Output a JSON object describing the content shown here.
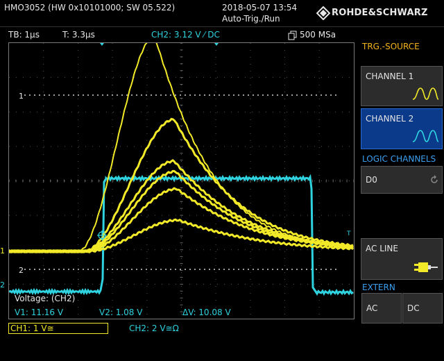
{
  "header": {
    "device": "HMO3052 (HW 0x10101000; SW 05.522)",
    "datetime": "2018-05-07 13:54",
    "mode": "Auto-Trig./Run",
    "brand": "ROHDE&SCHWARZ"
  },
  "status": {
    "timebase": "TB: 1µs",
    "trigger_pos": "T: 3.3µs",
    "trigger": "CH2: 3.12 V ⁄ DC",
    "samplerate": "500 MSa"
  },
  "side_menu": {
    "title": "TRG.-SOURCE",
    "channel1": "CHANNEL 1",
    "channel2": "CHANNEL 2",
    "logic_title": "LOGIC CHANNELS",
    "d0": "D0",
    "acline": "AC LINE",
    "extern_title": "EXTERN",
    "ac": "AC",
    "dc": "DC"
  },
  "measure": {
    "title": "Voltage: (CH2)",
    "v1": "V1: 11.16 V",
    "v2": "V2: 1.08 V",
    "dv": "ΔV: 10.08 V"
  },
  "footer": {
    "ch1": "CH1: 1 V≅",
    "ch2": "CH2: 2 V≅Ω"
  },
  "markers": {
    "cursor1": "1",
    "cursor2": "2",
    "ch1_level": "1",
    "ch2_level": "2",
    "trigger_tag": "T"
  },
  "colors": {
    "ch1": "#f2ea28",
    "ch2": "#2fd3e0",
    "menu_title": "#f4b41a",
    "menu_group": "#3aa0f0",
    "active_key": "#0b3a8a"
  }
}
